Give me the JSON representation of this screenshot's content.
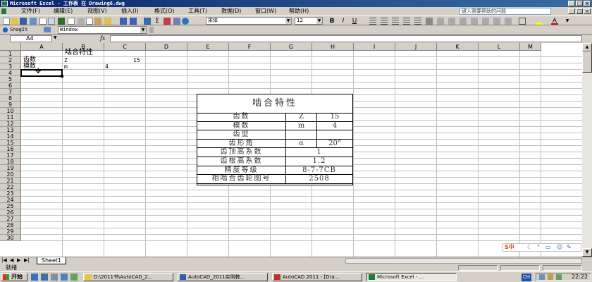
{
  "window": {
    "title": "Microsoft Excel - 工作表 在 Drawing6.dwg",
    "minimize": "_",
    "maximize": "□",
    "close": "×"
  },
  "menu": {
    "items": [
      "文件(F)",
      "编辑(E)",
      "视图(V)",
      "插入(I)",
      "格式(O)",
      "工具(T)",
      "数据(D)",
      "窗口(W)",
      "帮助(H)"
    ],
    "ask_placeholder": "键入需要帮助的问题"
  },
  "toolbar": {
    "font_name": "宋体",
    "font_size": "12",
    "bold": "B",
    "italic": "I",
    "underline": "U"
  },
  "toolbar2": {
    "snagit_label": "SnagIt",
    "window_label": "Window"
  },
  "formula": {
    "cell_ref": "A4",
    "fx": "fx",
    "content": ""
  },
  "grid": {
    "columns": [
      "A",
      "B",
      "C",
      "D",
      "E",
      "F",
      "G",
      "H",
      "I",
      "J",
      "K",
      "L",
      "M"
    ],
    "rows": [
      "1",
      "2",
      "3",
      "4",
      "5",
      "6",
      "7",
      "8",
      "9",
      "10",
      "11",
      "12",
      "13",
      "14",
      "15",
      "16",
      "17",
      "18",
      "19",
      "20",
      "21",
      "22",
      "23",
      "24",
      "25",
      "26",
      "27",
      "28",
      "29",
      "30"
    ],
    "cells": {
      "B1": "啮合特性",
      "A2": "齿数",
      "B2": "Z",
      "C2": "15",
      "A3": "模数",
      "B3": "m",
      "C3": "4"
    },
    "selected_cell": "A4"
  },
  "embedded_table": {
    "title": "啮合特性",
    "rows": [
      {
        "label": "齿数",
        "sym": "Z",
        "val": "15"
      },
      {
        "label": "模数",
        "sym": "m",
        "val": "4"
      },
      {
        "label": "齿型",
        "sym": "",
        "val": ""
      },
      {
        "label": "齿形角",
        "sym": "α",
        "val": "20°"
      },
      {
        "label": "齿顶高系数",
        "merged": "1"
      },
      {
        "label": "齿根高系数",
        "merged": "1.2"
      },
      {
        "label": "精度等级",
        "merged": "8-7-7CB"
      },
      {
        "label": "相啮合齿轮图号",
        "merged": "2508"
      }
    ]
  },
  "sheets": {
    "active": "Sheet1"
  },
  "status": {
    "text": "就绪"
  },
  "ime": {
    "label": "S中"
  },
  "taskbar": {
    "start": "开始",
    "tasks": [
      "D:\\2011书\\AutoCAD_2...",
      "AutoCAD_2011实例教...",
      "AutoCAD 2011 - [Dra...",
      "Microsoft Excel - ..."
    ],
    "tray_lang": "CH",
    "clock": "22:22"
  }
}
